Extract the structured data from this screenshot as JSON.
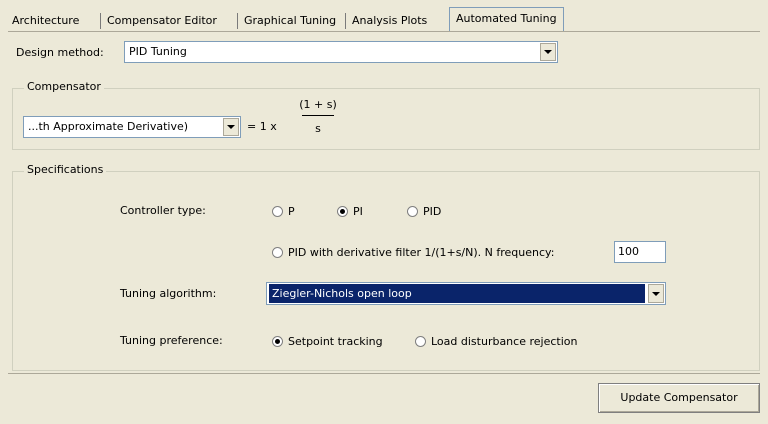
{
  "tabs": [
    {
      "label": "Architecture"
    },
    {
      "label": "Compensator Editor"
    },
    {
      "label": "Graphical Tuning"
    },
    {
      "label": "Analysis Plots"
    },
    {
      "label": "Automated Tuning",
      "active": true
    }
  ],
  "design": {
    "label": "Design method:",
    "value": "PID Tuning"
  },
  "compensator": {
    "title": "Compensator",
    "dropdown_value": "...th Approximate Derivative)",
    "equation_prefix": "= 1 x",
    "numerator": "(1 + s)",
    "denominator": "s"
  },
  "specs": {
    "title": "Specifications",
    "controller_type": {
      "label": "Controller type:",
      "options": [
        {
          "label": "P",
          "selected": false
        },
        {
          "label": "PI",
          "selected": true
        },
        {
          "label": "PID",
          "selected": false
        }
      ],
      "filter_option": {
        "label": "PID with derivative filter 1/(1+s/N). N frequency:",
        "selected": false
      },
      "n_frequency": "100"
    },
    "tuning_algorithm": {
      "label": "Tuning algorithm:",
      "value": "Ziegler-Nichols open loop"
    },
    "tuning_preference": {
      "label": "Tuning preference:",
      "options": [
        {
          "label": "Setpoint tracking",
          "selected": true
        },
        {
          "label": "Load disturbance rejection",
          "selected": false
        }
      ]
    }
  },
  "buttons": {
    "update": "Update Compensator"
  }
}
